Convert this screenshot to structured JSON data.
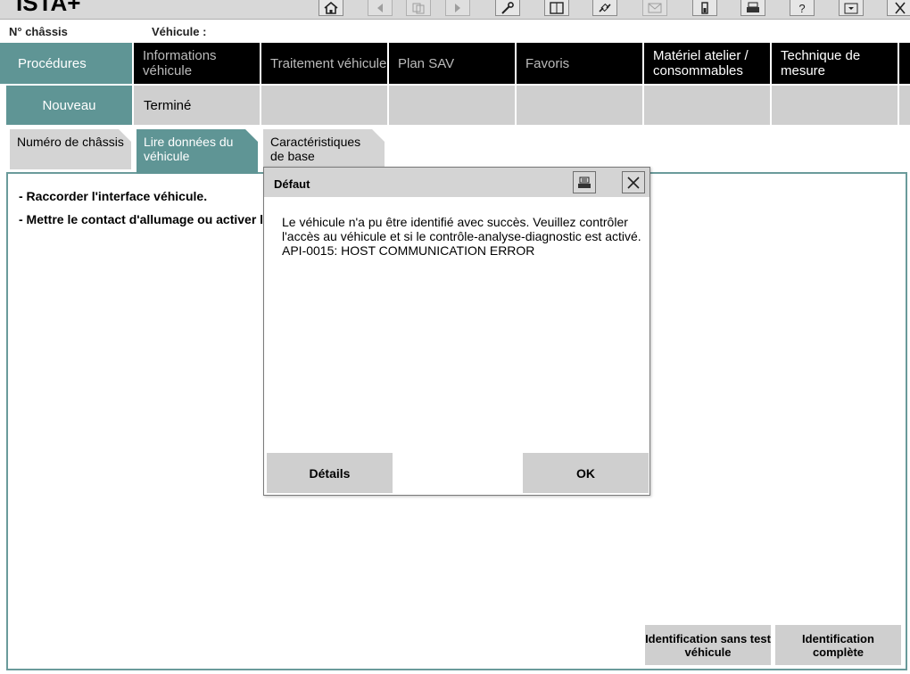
{
  "app": {
    "title": "ISTA+"
  },
  "toolbar": {
    "icons": [
      "home-icon",
      "back-icon",
      "copy-icon",
      "forward-icon",
      "wrench-icon",
      "book-icon",
      "connection-icon",
      "mail-icon",
      "battery-icon",
      "print-icon",
      "help-icon",
      "download-icon",
      "close-icon"
    ]
  },
  "info": {
    "chassis_label": "N° châssis",
    "vehicle_label": "Véhicule :"
  },
  "nav": {
    "items": [
      {
        "label": "Procédures"
      },
      {
        "label": "Informations véhicule"
      },
      {
        "label": "Traitement véhicule"
      },
      {
        "label": "Plan SAV"
      },
      {
        "label": "Favoris"
      },
      {
        "label": "Matériel atelier / consommables"
      },
      {
        "label": "Technique de mesure"
      }
    ]
  },
  "subnav": {
    "items": [
      {
        "label": "Nouveau"
      },
      {
        "label": "Terminé"
      }
    ]
  },
  "steps": {
    "items": [
      {
        "label": "Numéro de châssis"
      },
      {
        "label": "Lire données du véhicule"
      },
      {
        "label": "Caractéristiques de base"
      }
    ]
  },
  "content": {
    "instructions": [
      "- Raccorder l'interface véhicule.",
      "- Mettre le contact d'allumage ou activer l"
    ]
  },
  "bottom": {
    "identification_without_test": "Identification sans test véhicule",
    "identification_complete": "Identification complète"
  },
  "dialog": {
    "title": "Défaut",
    "message_line1": "Le véhicule n'a pu être identifié avec succès. Veuillez contrôler",
    "message_line2": "l'accès au véhicule et si le contrôle-analyse-diagnostic est activé.",
    "message_line3": "API-0015: HOST COMMUNICATION ERROR",
    "details_label": "Détails",
    "ok_label": "OK"
  },
  "colors": {
    "accent": "#5f9595",
    "nav_bg": "#000000",
    "tab_grey": "#cfcfcf",
    "frame": "#6a9b9b"
  }
}
